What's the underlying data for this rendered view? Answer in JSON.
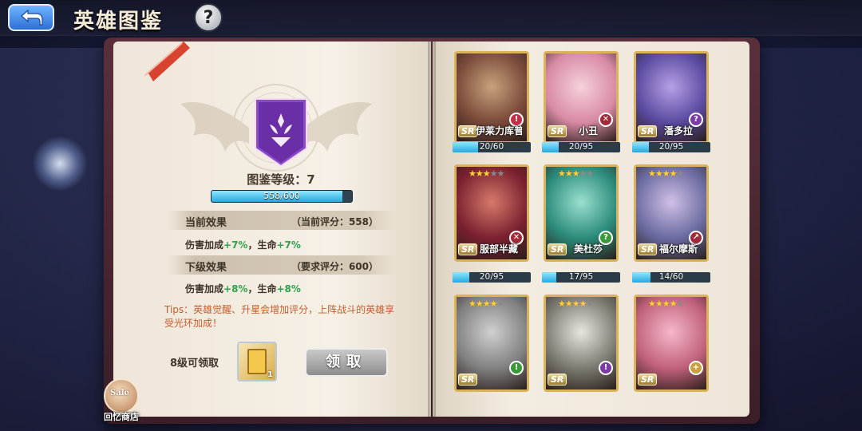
{
  "title": "英雄图鉴",
  "help_label": "?",
  "level": {
    "label": "图鉴等级：7",
    "progress_text": "558/600",
    "progress_fraction": 0.93
  },
  "current_effect": {
    "title": "当前效果",
    "score": "（当前评分：558）",
    "damage_label": "伤害加成",
    "damage_value": "+7%",
    "sep": "，生命",
    "hp_value": "+7%"
  },
  "next_effect": {
    "title": "下级效果",
    "score": "（要求评分：600）",
    "damage_label": "伤害加成",
    "damage_value": "+8%",
    "sep": "，生命",
    "hp_value": "+8%"
  },
  "tips": "Tips：英雄觉醒、升星会增加评分，上阵战斗的英雄享受光环加成！",
  "reward": {
    "label": "8级可领取",
    "count": "1",
    "claim_button": "领取"
  },
  "shop": {
    "badge": "Sale",
    "label": "回忆商店"
  },
  "colors": {
    "accent_blue": "#26a8e0",
    "gold_frame": "#d9b25a",
    "green_bonus": "#2fa34a",
    "tips_orange": "#c45e2c"
  },
  "heroes": [
    {
      "name": "伊莱力库普里",
      "rarity": "SR",
      "stars": 0,
      "progress": "20/60",
      "fraction": 0.33,
      "role_icon": "!",
      "role_color": "#c0304a"
    },
    {
      "name": "小丑",
      "rarity": "SR",
      "stars": 0,
      "progress": "20/95",
      "fraction": 0.21,
      "role_icon": "✕",
      "role_color": "#a02a3a"
    },
    {
      "name": "潘多拉",
      "rarity": "SR",
      "stars": 0,
      "progress": "20/95",
      "fraction": 0.21,
      "role_icon": "?",
      "role_color": "#7a3aa8"
    },
    {
      "name": "服部半藏",
      "rarity": "SR",
      "stars": 3,
      "progress": "20/95",
      "fraction": 0.21,
      "role_icon": "✕",
      "role_color": "#a02a3a"
    },
    {
      "name": "美杜莎",
      "rarity": "SR",
      "stars": 3,
      "progress": "17/95",
      "fraction": 0.18,
      "role_icon": "?",
      "role_color": "#3a9a3a"
    },
    {
      "name": "福尔摩斯",
      "rarity": "SR",
      "stars": 4,
      "progress": "14/60",
      "fraction": 0.23,
      "role_icon": "↗",
      "role_color": "#a02a3a"
    },
    {
      "name": "",
      "rarity": "SR",
      "stars": 4,
      "progress": "",
      "fraction": 0,
      "role_icon": "!",
      "role_color": "#3a9a3a"
    },
    {
      "name": "",
      "rarity": "SR",
      "stars": 4,
      "progress": "",
      "fraction": 0,
      "role_icon": "!",
      "role_color": "#7a3aa8"
    },
    {
      "name": "",
      "rarity": "SR",
      "stars": 4,
      "progress": "",
      "fraction": 0,
      "role_icon": "+",
      "role_color": "#c9a040"
    }
  ]
}
